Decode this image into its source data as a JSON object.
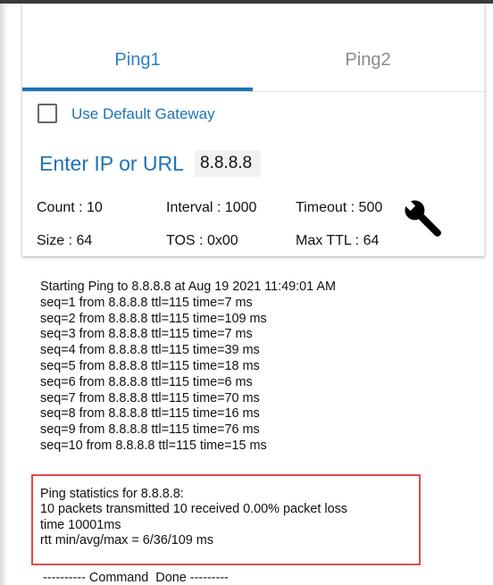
{
  "tabs": {
    "ping1": "Ping1",
    "ping2": "Ping2",
    "active": "Ping1"
  },
  "gateway": {
    "label": "Use Default Gateway",
    "checked": false
  },
  "target": {
    "label": "Enter IP or URL",
    "value": "8.8.8.8"
  },
  "params": {
    "count": "Count : 10",
    "interval": "Interval : 1000",
    "timeout": "Timeout : 500",
    "size": "Size : 64",
    "tos": "TOS : 0x00",
    "max_ttl": "Max TTL : 64"
  },
  "settings_icon": "wrench-icon",
  "log": {
    "header": "Starting Ping to 8.8.8.8 at Aug 19 2021 11:49:01 AM",
    "lines": [
      "seq=1 from 8.8.8.8 ttl=115 time=7 ms",
      "seq=2 from 8.8.8.8 ttl=115 time=109 ms",
      "seq=3 from 8.8.8.8 ttl=115 time=7 ms",
      "seq=4 from 8.8.8.8 ttl=115 time=39 ms",
      "seq=5 from 8.8.8.8 ttl=115 time=18 ms",
      "seq=6 from 8.8.8.8 ttl=115 time=6 ms",
      "seq=7 from 8.8.8.8 ttl=115 time=70 ms",
      "seq=8 from 8.8.8.8 ttl=115 time=16 ms",
      "seq=9 from 8.8.8.8 ttl=115 time=76 ms",
      "seq=10 from 8.8.8.8 ttl=115 time=15 ms"
    ]
  },
  "statistics": {
    "title": "Ping statistics for 8.8.8.8:",
    "packets": "10 packets transmitted 10 received 0.00% packet loss",
    "time": "time 10001ms",
    "rtt": "rtt min/avg/max = 6/36/109 ms"
  },
  "done": "---------- Command  Done ---------",
  "colors": {
    "accent": "#1f73b7",
    "tab_active": "#2f7fc1",
    "tab_inactive": "#8a8a8a",
    "highlight_box": "#e34a4a"
  }
}
